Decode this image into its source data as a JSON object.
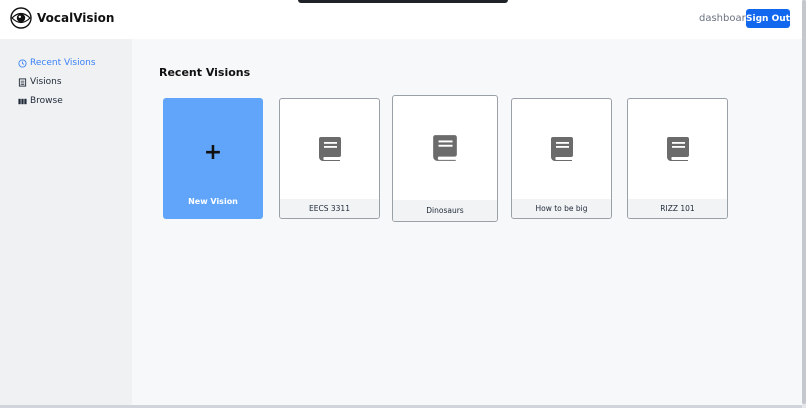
{
  "header": {
    "brand": "VocalVision",
    "nav_link": "dashboard",
    "signout_label": "Sign Out",
    "logo_icon": "eye-logo-icon",
    "accent_color": "#1168ee"
  },
  "sidebar": {
    "items": [
      {
        "label": "Recent Visions",
        "icon": "clock-icon",
        "active": true
      },
      {
        "label": "Visions",
        "icon": "stack-icon",
        "active": false
      },
      {
        "label": "Browse",
        "icon": "grid-icon",
        "active": false
      }
    ],
    "active_color": "#3b82f6"
  },
  "main": {
    "title": "Recent Visions",
    "new_card": {
      "symbol": "+",
      "label": "New Vision",
      "color": "#60a5fa"
    },
    "cards": [
      {
        "label": "EECS 3311",
        "icon": "book-icon"
      },
      {
        "label": "Dinosaurs",
        "icon": "book-icon"
      },
      {
        "label": "How to be big",
        "icon": "book-icon"
      },
      {
        "label": "RIZZ 101",
        "icon": "book-icon"
      }
    ]
  }
}
